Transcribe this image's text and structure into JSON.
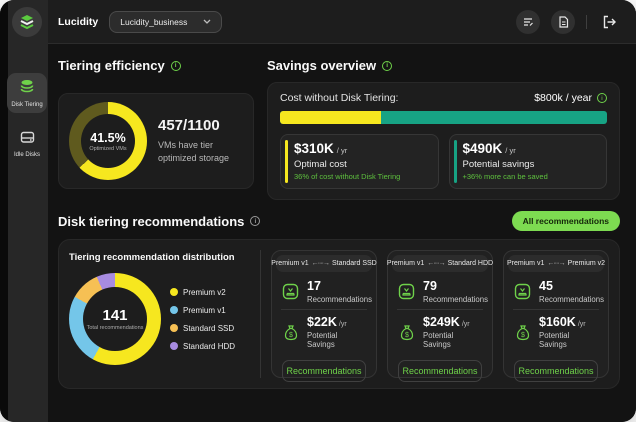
{
  "colors": {
    "accent_green": "#6FD24A",
    "button_green": "#7DDB51",
    "yellow": "#F6E71F",
    "teal": "#17A384",
    "olive": "#5F5A1E",
    "blue": "#74C6E9",
    "orange": "#F6C054",
    "purple": "#A78BE0"
  },
  "icons": {
    "info": "i",
    "bidir_arrow": "←····→"
  },
  "topbar": {
    "brand": "Lucidity",
    "org_selector_value": "Lucidity_business"
  },
  "sidebar": {
    "items": [
      {
        "label": "Disk Tiering"
      },
      {
        "label": "Idle Disks"
      }
    ]
  },
  "tiering_efficiency": {
    "title": "Tiering efficiency",
    "percent": "41.5%",
    "percent_sub": "Optimized VMs",
    "ratio": "457/1100",
    "ratio_sub": "VMs have tier optimized storage",
    "donut": [
      {
        "color": "#F6E71F",
        "from": 0,
        "to": 63
      },
      {
        "color": "#5F5A1E",
        "from": 63,
        "to": 100
      }
    ]
  },
  "savings_overview": {
    "title": "Savings overview",
    "cost_label": "Cost without Disk Tiering:",
    "cost_value": "$800k / year",
    "bar_yellow_percent": 31,
    "boxes": [
      {
        "value": "$310K",
        "unit": "/ yr",
        "label": "Optimal cost",
        "sub": "36% of cost without Disk Tiering",
        "accent": "#F6E71F"
      },
      {
        "value": "$490K",
        "unit": "/ yr",
        "label": "Potential savings",
        "sub": "+36% more can be saved",
        "accent": "#17A384"
      }
    ]
  },
  "recommendations": {
    "title": "Disk tiering recommendations",
    "all_button_label": "All recommendations",
    "distribution": {
      "title": "Tiering recommendation distribution",
      "total": "141",
      "total_sub": "Total recommendations",
      "donut": [
        {
          "color": "#F6E71F",
          "from": 0,
          "to": 58
        },
        {
          "color": "#74C6E9",
          "from": 58,
          "to": 83
        },
        {
          "color": "#F6C054",
          "from": 83,
          "to": 93.5
        },
        {
          "color": "#A78BE0",
          "from": 93.5,
          "to": 100
        }
      ],
      "legend": [
        {
          "label": "Premium v2",
          "color": "#F6E71F"
        },
        {
          "label": "Premium v1",
          "color": "#74C6E9"
        },
        {
          "label": "Standard SSD",
          "color": "#F6C054"
        },
        {
          "label": "Standard HDD",
          "color": "#A78BE0"
        }
      ]
    },
    "cards": [
      {
        "from": "Premium v1",
        "to": "Standard SSD",
        "count": "17",
        "count_label": "Recommendations",
        "savings": "$22K",
        "savings_unit": "/yr",
        "savings_label": "Potential Savings",
        "button_label": "Recommendations"
      },
      {
        "from": "Premium v1",
        "to": "Standard HDD",
        "count": "79",
        "count_label": "Recommendations",
        "savings": "$249K",
        "savings_unit": "/yr",
        "savings_label": "Potential Savings",
        "button_label": "Recommendations"
      },
      {
        "from": "Premium v1",
        "to": "Premium v2",
        "count": "45",
        "count_label": "Recommendations",
        "savings": "$160K",
        "savings_unit": "/yr",
        "savings_label": "Potential Savings",
        "button_label": "Recommendations"
      }
    ]
  }
}
